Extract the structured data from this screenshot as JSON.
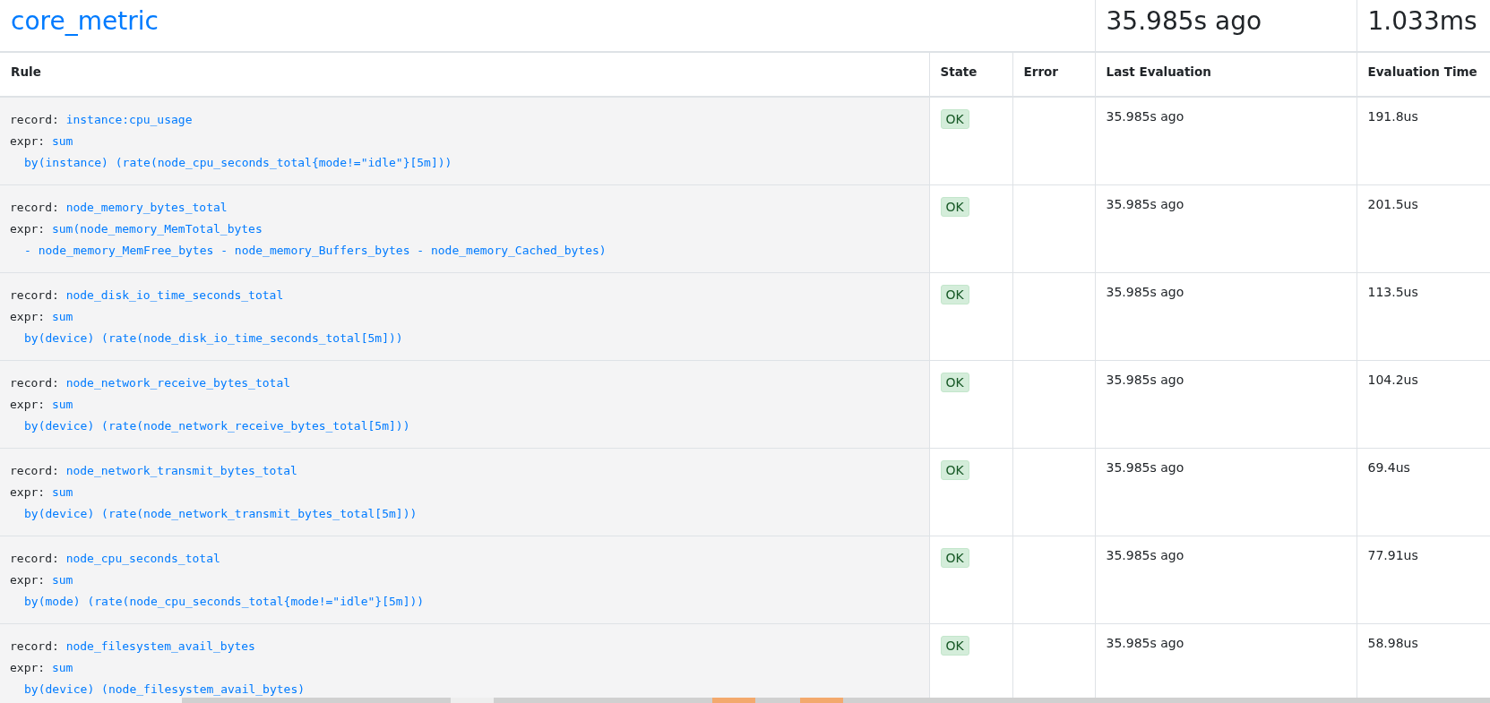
{
  "group": {
    "name": "core_metric",
    "last_evaluation": "35.985s ago",
    "evaluation_time": "1.033ms"
  },
  "columns": [
    "Rule",
    "State",
    "Error",
    "Last Evaluation",
    "Evaluation Time"
  ],
  "rows": [
    {
      "record_label": "record:",
      "record": "instance:cpu_usage",
      "expr_label": "expr:",
      "expr": [
        "sum",
        "by(instance) (rate(node_cpu_seconds_total{mode!=\"idle\"}[5m]))"
      ],
      "state": "OK",
      "last_evaluation": "35.985s ago",
      "evaluation_time": "191.8us"
    },
    {
      "record_label": "record:",
      "record": "node_memory_bytes_total",
      "expr_label": "expr:",
      "expr": [
        "sum(node_memory_MemTotal_bytes",
        "- node_memory_MemFree_bytes - node_memory_Buffers_bytes - node_memory_Cached_bytes)"
      ],
      "state": "OK",
      "last_evaluation": "35.985s ago",
      "evaluation_time": "201.5us"
    },
    {
      "record_label": "record:",
      "record": "node_disk_io_time_seconds_total",
      "expr_label": "expr:",
      "expr": [
        "sum",
        "by(device) (rate(node_disk_io_time_seconds_total[5m]))"
      ],
      "state": "OK",
      "last_evaluation": "35.985s ago",
      "evaluation_time": "113.5us"
    },
    {
      "record_label": "record:",
      "record": "node_network_receive_bytes_total",
      "expr_label": "expr:",
      "expr": [
        "sum",
        "by(device) (rate(node_network_receive_bytes_total[5m]))"
      ],
      "state": "OK",
      "last_evaluation": "35.985s ago",
      "evaluation_time": "104.2us"
    },
    {
      "record_label": "record:",
      "record": "node_network_transmit_bytes_total",
      "expr_label": "expr:",
      "expr": [
        "sum",
        "by(device) (rate(node_network_transmit_bytes_total[5m]))"
      ],
      "state": "OK",
      "last_evaluation": "35.985s ago",
      "evaluation_time": "69.4us"
    },
    {
      "record_label": "record:",
      "record": "node_cpu_seconds_total",
      "expr_label": "expr:",
      "expr": [
        "sum",
        "by(mode) (rate(node_cpu_seconds_total{mode!=\"idle\"}[5m]))"
      ],
      "state": "OK",
      "last_evaluation": "35.985s ago",
      "evaluation_time": "77.91us"
    },
    {
      "record_label": "record:",
      "record": "node_filesystem_avail_bytes",
      "expr_label": "expr:",
      "expr": [
        "sum",
        "by(device) (node_filesystem_avail_bytes)"
      ],
      "state": "OK",
      "last_evaluation": "35.985s ago",
      "evaluation_time": "58.98us"
    }
  ]
}
